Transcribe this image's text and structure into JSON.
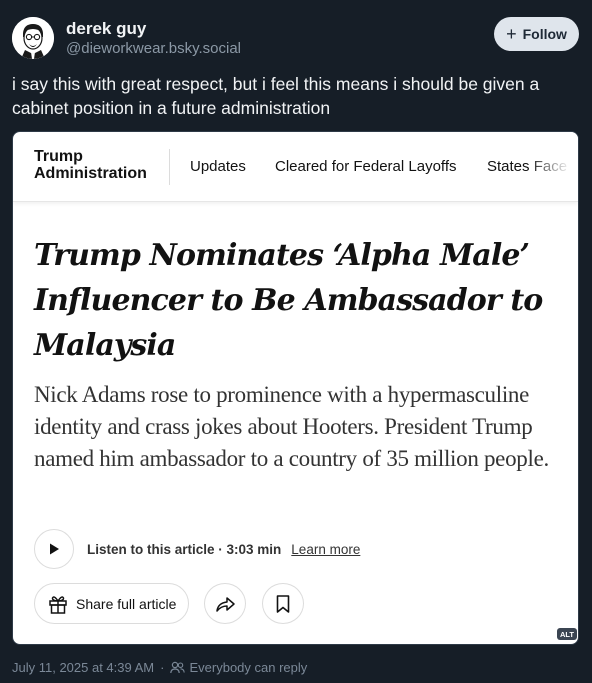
{
  "author": {
    "display_name": "derek guy",
    "handle": "@dieworkwear.bsky.social"
  },
  "follow_button": {
    "label": "Follow"
  },
  "post": {
    "text": "i say this with great respect, but i feel this means i should be given a cabinet position in a future administration"
  },
  "embed_image": {
    "section_title": "Trump Administration",
    "nav_links": [
      "Updates",
      "Cleared for Federal Layoffs",
      "States Face t"
    ],
    "headline": "Trump Nominates ‘Alpha Male’ Influencer to Be Ambassador to Malaysia",
    "summary": "Nick Adams rose to prominence with a hypermasculine identity and crass jokes about Hooters. President Trump named him ambassador to a country of 35 million people.",
    "listen_label": "Listen to this article · 3:03 min",
    "learn_more": "Learn more",
    "share_label": "Share full article",
    "alt_badge": "ALT",
    "icons": [
      "play-icon",
      "gift-icon",
      "share-arrow-icon",
      "bookmark-icon"
    ]
  },
  "footer": {
    "timestamp": "July 11, 2025 at 4:39 AM",
    "reply_setting": "Everybody can reply"
  },
  "colors": {
    "background": "#161e27",
    "follow_bg": "#dfe5ec",
    "muted_text": "#8b98a5"
  }
}
